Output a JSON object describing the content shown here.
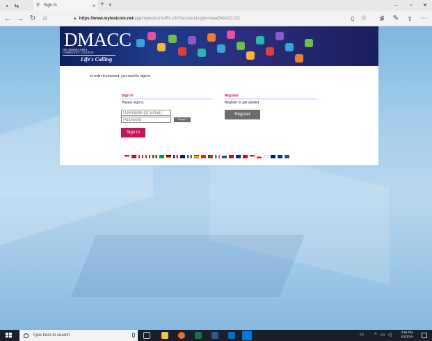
{
  "browser": {
    "tab_title": "Sign In",
    "new_tab_label": "+",
    "tab_menu_label": "∨",
    "url_host": "https://www.mytestcom.net",
    "url_path": "/app/mytestcomURL.cfm?accountLogin=IowaDMACC123",
    "window_controls": [
      "–",
      "▫",
      "✕"
    ]
  },
  "banner": {
    "logo": "DMACC",
    "subtitle_line1": "DES MOINES AREA",
    "subtitle_line2": "COMMUNITY COLLEGE",
    "tagline": "Life's Calling"
  },
  "content": {
    "intro": "In order to proceed, you need to sign in.",
    "signin": {
      "heading": "Sign In",
      "prompt": "Please sign in.",
      "username_placeholder": "Username (or Email)",
      "password_placeholder": "Password",
      "forgot_label": "Forgot?",
      "button_label": "Sign In"
    },
    "register": {
      "heading": "Register",
      "prompt": "Register to get started.",
      "button_label": "Register"
    }
  },
  "taskbar": {
    "search_placeholder": "Type here to search",
    "time": "3:58 PM",
    "date": "4/1/2019"
  },
  "colors": {
    "accent": "#c2185b",
    "button_gray": "#6d6d6d",
    "banner_navy": "#1e3b8a"
  }
}
